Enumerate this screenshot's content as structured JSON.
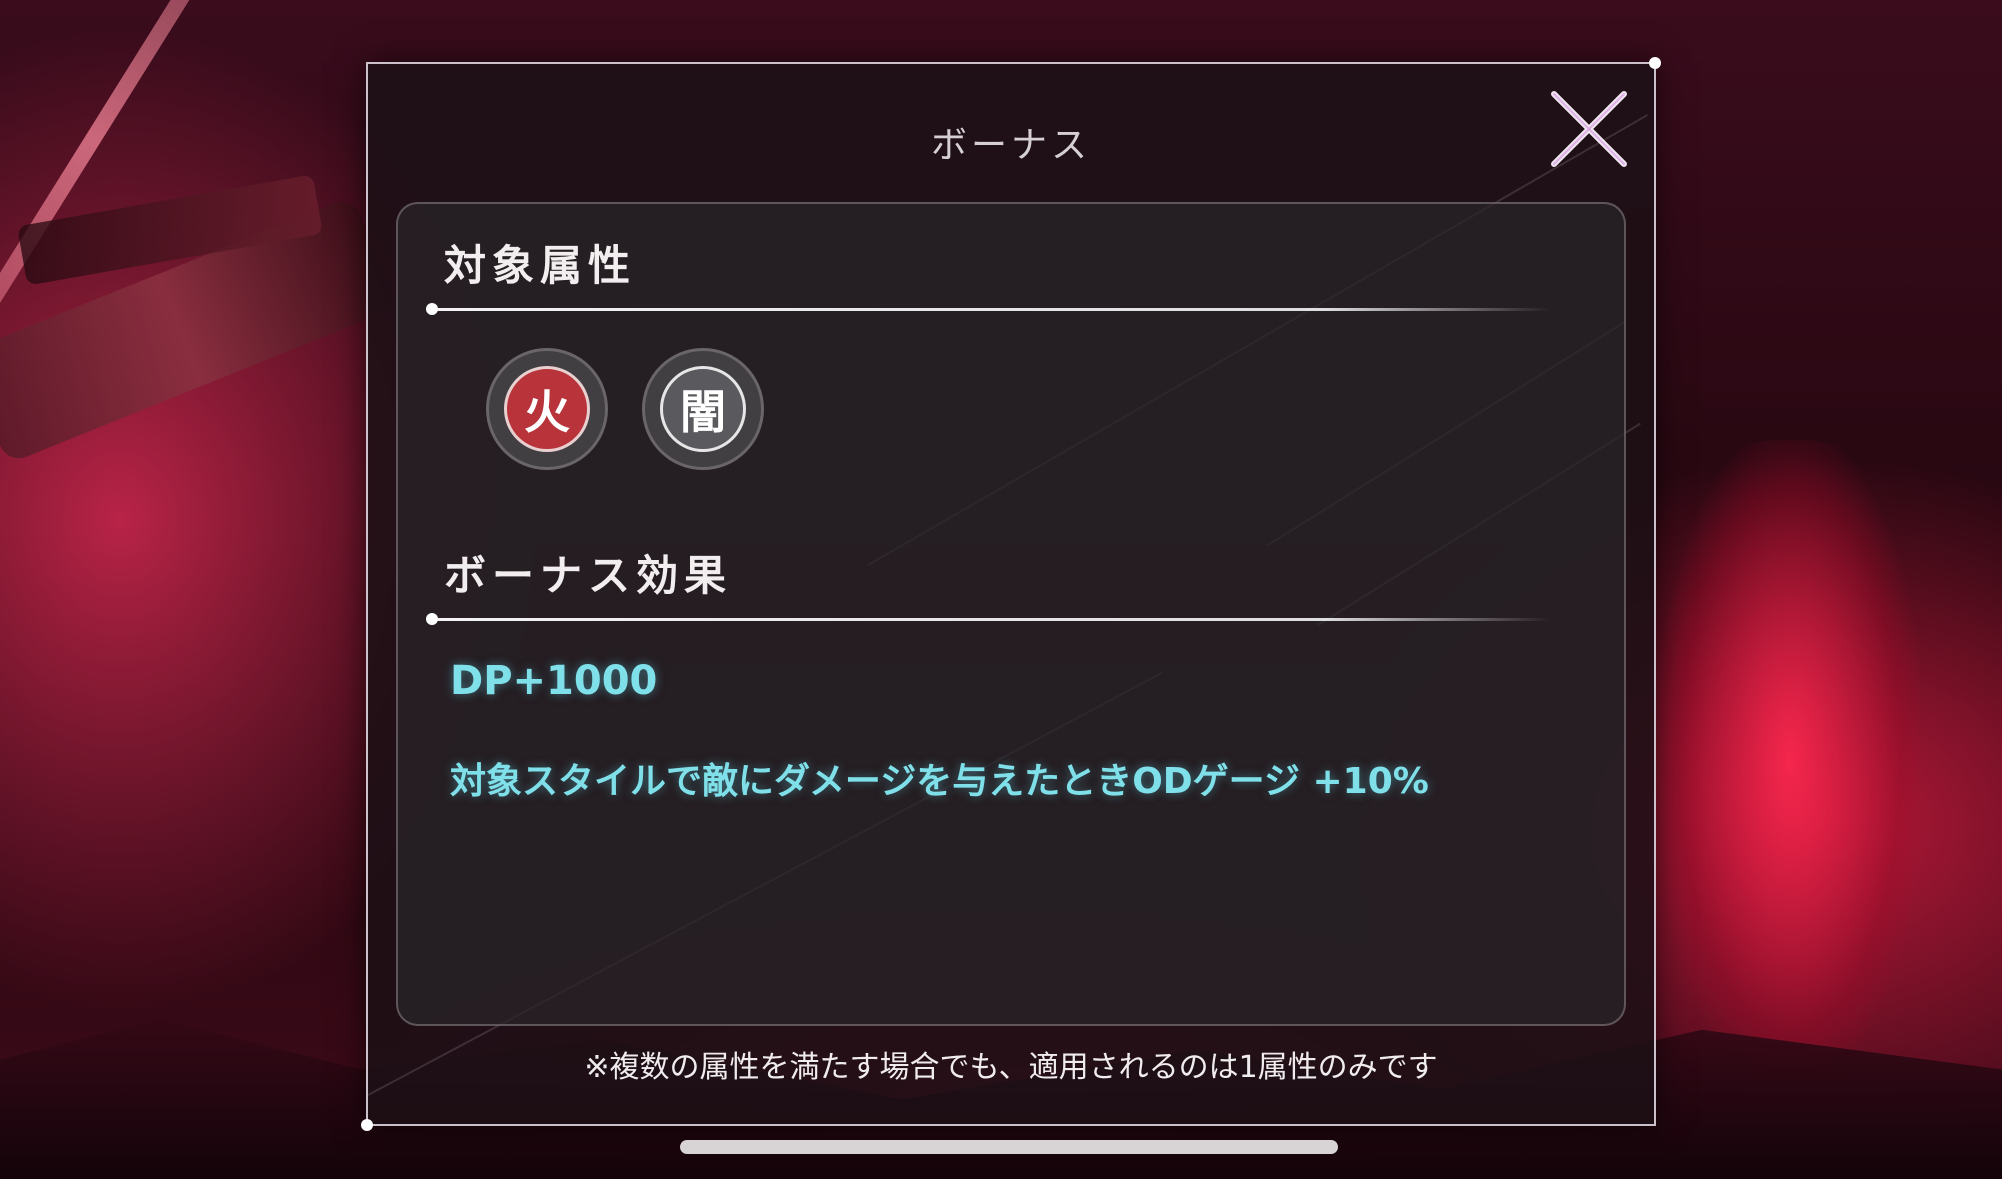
{
  "dialog": {
    "title": "ボーナス",
    "close_icon": "close-x-icon"
  },
  "target_attributes": {
    "heading": "対象属性",
    "items": [
      {
        "label": "火",
        "icon": "fire-attribute-icon",
        "color": "#b8343a"
      },
      {
        "label": "闇",
        "icon": "dark-attribute-icon",
        "color": "#5a5a5e"
      }
    ]
  },
  "bonus_effects": {
    "heading": "ボーナス効果",
    "lines": [
      "DP+1000",
      "対象スタイルで敵にダメージを与えたときODゲージ +10%"
    ],
    "text_color": "#7fe0ea"
  },
  "footer_note": "※複数の属性を満たす場合でも、適用されるのは1属性のみです"
}
